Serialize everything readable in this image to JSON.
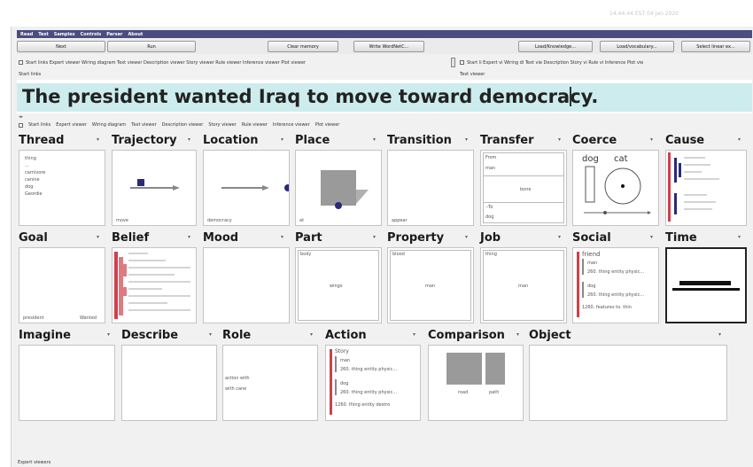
{
  "timestamp": "14:44:44 EST 04 Jan 2020",
  "menu": [
    "Read",
    "Test",
    "Samples",
    "Controls",
    "Parser",
    "About"
  ],
  "buttons": {
    "next": "Next",
    "run": "Run",
    "clear_memory": "Clear memory",
    "write_wordnet": "Write WordNetC...",
    "load_knowledge": "Load/Knowledge...",
    "load_vocabulary": "Load/vocabulary...",
    "select_linear": "Select linear ex..."
  },
  "tabs_left": "Start links  Expert viewer  Wiring diagram  Text viewer  Description viewer  Story viewer  Rule viewer  Inference viewer  Plot viewer",
  "tabs_right": "Start li  Expert vi  Wiring di  Text vie  Description  Story vi  Rule vi  Inference  Plot vie",
  "start_links_label": "Start links",
  "text_viewer_label": "Text viewer",
  "sentence": "The president wanted Iraq to move toward democracy.",
  "viewer_tabs": [
    "Start links",
    "Expert viewer",
    "Wiring diagram",
    "Text viewer",
    "Description viewer",
    "Story viewer",
    "Rule viewer",
    "Inference viewer",
    "Plot viewer"
  ],
  "panels": {
    "thread": {
      "title": "Thread",
      "items": [
        "thing",
        "...",
        "carnivore",
        "canine",
        "dog",
        "Geordie"
      ]
    },
    "trajectory": {
      "title": "Trajectory",
      "caption": "move"
    },
    "location": {
      "title": "Location",
      "caption": "democracy"
    },
    "place": {
      "title": "Place",
      "caption": "at"
    },
    "transition": {
      "title": "Transition",
      "caption": "appear"
    },
    "transfer": {
      "title": "Transfer",
      "rows": [
        "From",
        "man",
        "",
        "--To",
        "dog"
      ],
      "object": "bone"
    },
    "coerce": {
      "title": "Coerce",
      "left": "dog",
      "right": "cat"
    },
    "cause": {
      "title": "Cause"
    },
    "goal": {
      "title": "Goal",
      "left_caption": "president",
      "right_caption": "Wanted"
    },
    "belief": {
      "title": "Belief"
    },
    "mood": {
      "title": "Mood"
    },
    "part": {
      "title": "Part",
      "top": "body",
      "center": "wings"
    },
    "property": {
      "title": "Property",
      "top": "blood",
      "center": "man"
    },
    "job": {
      "title": "Job",
      "top": "thing",
      "center": "man"
    },
    "social": {
      "title": "Social",
      "head": "friend",
      "lines": [
        "man",
        "260. thing entity physic...",
        "dog",
        "260. thing entity physic...",
        "1260. features to. thin"
      ]
    },
    "time": {
      "title": "Time"
    },
    "imagine": {
      "title": "Imagine"
    },
    "describe": {
      "title": "Describe"
    },
    "role": {
      "title": "Role",
      "line1": "action  with",
      "line2": "with     cane"
    },
    "action": {
      "title": "Action",
      "head": "Story",
      "lines": [
        "man",
        "260. thing entity physic...",
        "dog",
        "260. thing entity physic...",
        "1260. thing entity destro"
      ]
    },
    "comparison": {
      "title": "Comparison",
      "left": "road",
      "right": "path"
    },
    "object": {
      "title": "Object"
    }
  },
  "footer": "Expert viewers",
  "colors": {
    "menubar": "#4b4c82",
    "highlight": "#cdecee",
    "red": "#d0404a",
    "navy": "#2a2a7a",
    "gray_box": "#9a9a9a"
  }
}
